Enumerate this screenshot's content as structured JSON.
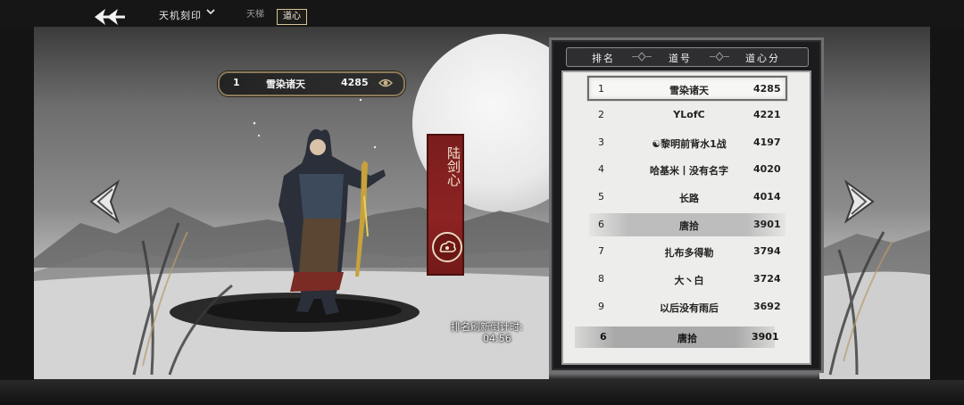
{
  "topbar": {
    "breadcrumb": "天机刻印",
    "tabs": [
      {
        "label": "天梯",
        "active": false
      },
      {
        "label": "道心",
        "active": true
      }
    ]
  },
  "selected_player": {
    "rank": "1",
    "name": "雪染诸天",
    "score": "4285"
  },
  "banner": {
    "title": "陆剑心"
  },
  "countdown": {
    "label": "排名刷新倒计时:",
    "time": "04:56"
  },
  "leaderboard": {
    "headers": {
      "rank": "排名",
      "name": "道号",
      "score": "道心分"
    },
    "rows": [
      {
        "rank": "1",
        "name": "雪染诸天",
        "score": "4285",
        "state": "selected"
      },
      {
        "rank": "2",
        "name": "YLofC",
        "score": "4221",
        "state": "normal"
      },
      {
        "rank": "3",
        "name": "☯黎明前背水1战",
        "score": "4197",
        "state": "normal"
      },
      {
        "rank": "4",
        "name": "哈基米丨没有名字",
        "score": "4020",
        "state": "normal"
      },
      {
        "rank": "5",
        "name": "长路",
        "score": "4014",
        "state": "normal"
      },
      {
        "rank": "6",
        "name": "唐拾",
        "score": "3901",
        "state": "highlight"
      },
      {
        "rank": "7",
        "name": "扎布多得勒",
        "score": "3794",
        "state": "normal"
      },
      {
        "rank": "8",
        "name": "大丶白",
        "score": "3724",
        "state": "normal"
      },
      {
        "rank": "9",
        "name": "以后没有雨后",
        "score": "3692",
        "state": "normal"
      }
    ],
    "self": {
      "rank": "6",
      "name": "唐拾",
      "score": "3901"
    }
  },
  "icons": {
    "back": "back-arrow-icon",
    "dropdown": "chevron-down-icon",
    "prev": "arrow-left-icon",
    "next": "arrow-right-icon",
    "chip_badge": "eye-emblem-icon",
    "banner_emblem": "cloud-emblem-icon"
  },
  "colors": {
    "banner": "#8d2323",
    "tab_active_border": "#d7c39a",
    "panel_bg": "#ededeb"
  }
}
